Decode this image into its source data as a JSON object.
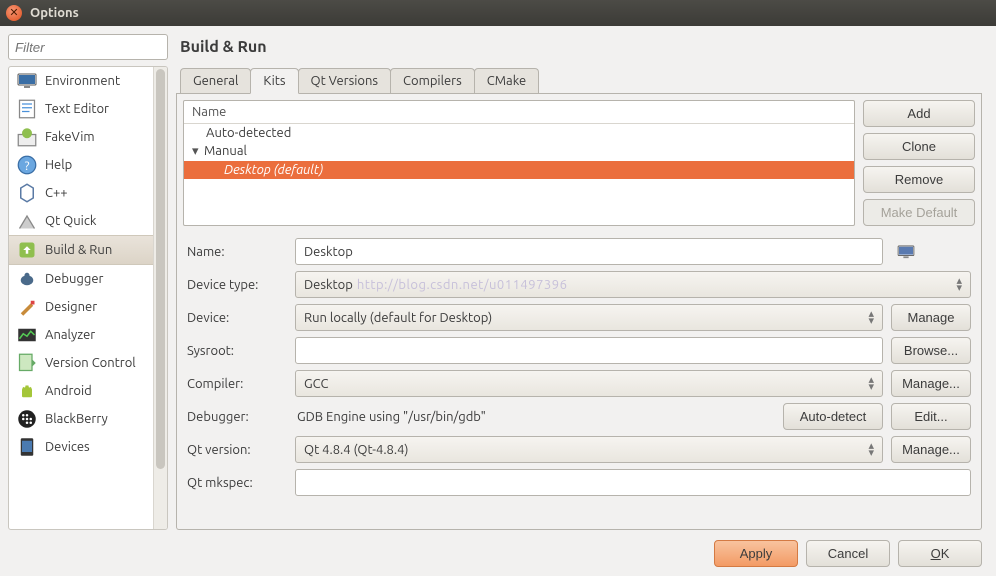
{
  "window": {
    "title": "Options"
  },
  "sidebar": {
    "filter_placeholder": "Filter",
    "items": [
      {
        "label": "Environment"
      },
      {
        "label": "Text Editor"
      },
      {
        "label": "FakeVim"
      },
      {
        "label": "Help"
      },
      {
        "label": "C++"
      },
      {
        "label": "Qt Quick"
      },
      {
        "label": "Build & Run"
      },
      {
        "label": "Debugger"
      },
      {
        "label": "Designer"
      },
      {
        "label": "Analyzer"
      },
      {
        "label": "Version Control"
      },
      {
        "label": "Android"
      },
      {
        "label": "BlackBerry"
      },
      {
        "label": "Devices"
      }
    ]
  },
  "main": {
    "heading": "Build & Run",
    "tabs": [
      "General",
      "Kits",
      "Qt Versions",
      "Compilers",
      "CMake"
    ],
    "tree": {
      "header": "Name",
      "groups": [
        {
          "label": "Auto-detected"
        },
        {
          "label": "Manual",
          "children": [
            {
              "label": "Desktop (default)"
            }
          ]
        }
      ]
    },
    "buttons": {
      "add": "Add",
      "clone": "Clone",
      "remove": "Remove",
      "make_default": "Make Default",
      "manage": "Manage",
      "browse": "Browse...",
      "manage_dots": "Manage...",
      "autodetect": "Auto-detect",
      "edit": "Edit..."
    },
    "form": {
      "name_label": "Name:",
      "name_value": "Desktop",
      "devtype_label": "Device type:",
      "devtype_value": "Desktop",
      "device_label": "Device:",
      "device_value": "Run locally (default for Desktop)",
      "sysroot_label": "Sysroot:",
      "sysroot_value": "",
      "compiler_label": "Compiler:",
      "compiler_value": "GCC",
      "debugger_label": "Debugger:",
      "debugger_value": "GDB Engine using \"/usr/bin/gdb\"",
      "qtver_label": "Qt version:",
      "qtver_value": "Qt 4.8.4 (Qt-4.8.4)",
      "mkspec_label": "Qt mkspec:",
      "mkspec_value": "",
      "watermark": "http://blog.csdn.net/u011497396"
    }
  },
  "footer": {
    "apply": "Apply",
    "cancel": "Cancel",
    "ok": "OK"
  }
}
